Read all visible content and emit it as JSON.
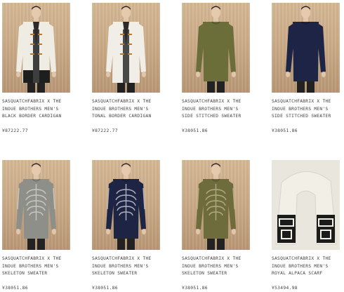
{
  "products": [
    {
      "title": "SASQUATCHFABRIX X THE INOUE BROTHERS MEN'S BLACK BORDER CARDIGAN",
      "price": "¥87222.77",
      "image": "cream cardigan with toggles and black jacquard border",
      "garment_color": "#efece4",
      "accent_color": "#1e1e1e"
    },
    {
      "title": "SASQUATCHFABRIX X THE INOUE BROTHERS MEN'S TONAL BORDER CARDIGAN",
      "price": "¥87222.77",
      "image": "cream cardigan with toggles and tonal border",
      "garment_color": "#f1eee7",
      "accent_color": "#f1eee7"
    },
    {
      "title": "SASQUATCHFABRIX X THE INOUE BROTHERS MEN'S SIDE STITCHED SWEATER",
      "price": "¥38051.86",
      "image": "olive green crew neck sweater",
      "garment_color": "#6c6e3a",
      "accent_color": "#6c6e3a"
    },
    {
      "title": "SASQUATCHFABRIX X THE INOUE BROTHERS MEN'S SIDE STITCHED SWEATER",
      "price": "¥38051.86",
      "image": "navy crew neck sweater",
      "garment_color": "#1d2445",
      "accent_color": "#1d2445"
    },
    {
      "title": "SASQUATCHFABRIX X THE INOUE BROTHERS MEN'S SKELETON SWEATER",
      "price": "¥38051.86",
      "image": "grey sweater with skeleton print",
      "garment_color": "#8e8f89",
      "accent_color": "#c9cac4"
    },
    {
      "title": "SASQUATCHFABRIX X THE INOUE BROTHERS MEN'S SKELETON SWEATER",
      "price": "¥38051.86",
      "image": "navy sweater with skeleton print",
      "garment_color": "#1e2444",
      "accent_color": "#b7b9c2"
    },
    {
      "title": "SASQUATCHFABRIX X THE INOUE BROTHERS MEN'S SKELETON SWEATER",
      "price": "¥38051.86",
      "image": "olive sweater with skeleton print",
      "garment_color": "#6e6b3c",
      "accent_color": "#b6ad84"
    },
    {
      "title": "SASQUATCHFABRIX X THE INOUE BROTHERS MEN'S ROYAL ALPACA SCARF",
      "price": "¥53494.98",
      "image": "cream alpaca scarf with black jacquard ends",
      "garment_color": "#f2efe7",
      "accent_color": "#1b1b1b"
    }
  ]
}
